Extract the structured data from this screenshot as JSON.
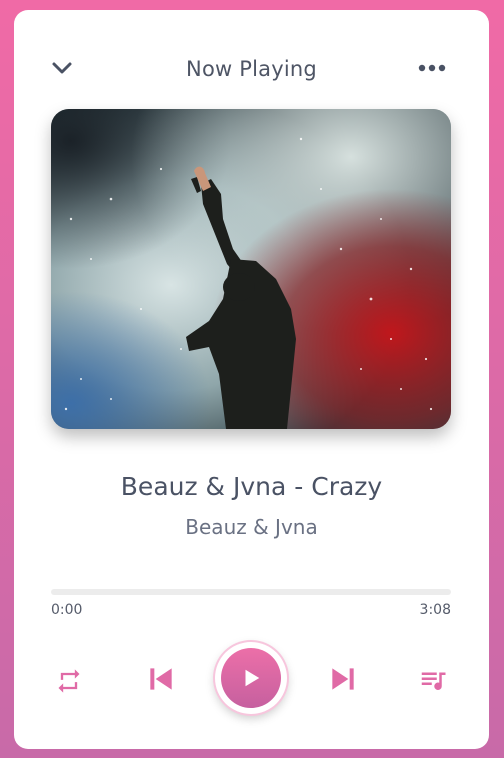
{
  "header": {
    "title": "Now Playing",
    "collapse_icon": "chevron-down-icon",
    "more_icon": "more-horizontal-icon"
  },
  "track": {
    "title": "Beauz & Jvna - Crazy",
    "artist": "Beauz & Jvna",
    "album_art": "concert-performer-smoke-photo"
  },
  "progress": {
    "current": "0:00",
    "duration": "3:08",
    "fraction": 0
  },
  "controls": {
    "repeat_icon": "repeat-icon",
    "previous_icon": "skip-previous-icon",
    "play_icon": "play-icon",
    "next_icon": "skip-next-icon",
    "queue_icon": "queue-music-icon"
  },
  "colors": {
    "accent": "#e06aa6",
    "background_top": "#f06aa6",
    "background_bottom": "#c86aa8"
  }
}
